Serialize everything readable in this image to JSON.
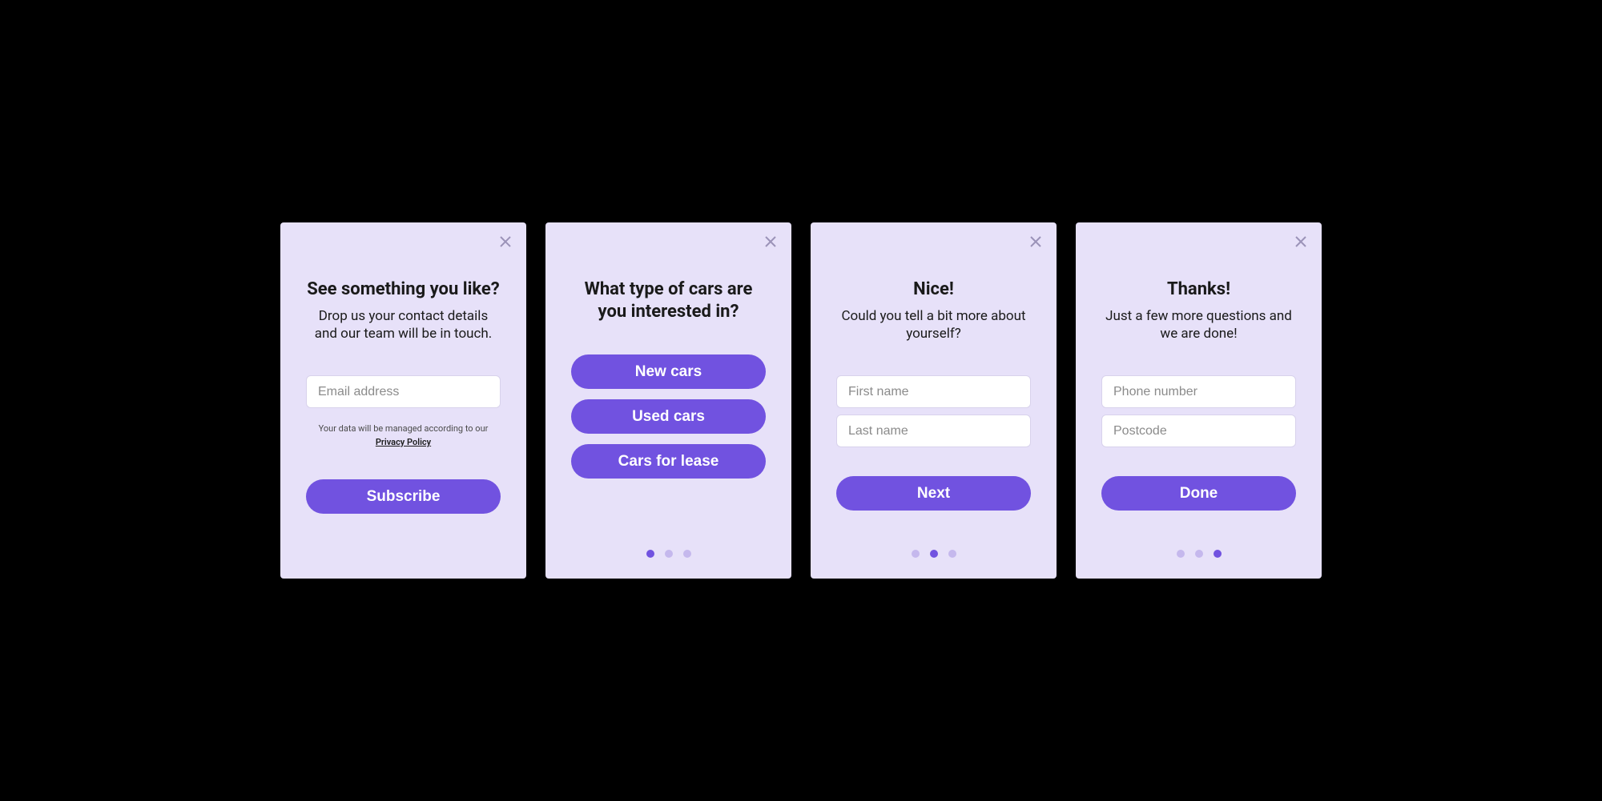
{
  "colors": {
    "accent": "#7152e0",
    "card_bg": "#e7e1f9"
  },
  "cards": [
    {
      "title": "See something you like?",
      "subtitle": "Drop us your contact details and our team will be in touch.",
      "email_placeholder": "Email address",
      "disclaimer_prefix": "Your data will be managed according to our ",
      "disclaimer_link": "Privacy Policy",
      "subscribe_label": "Subscribe"
    },
    {
      "title": "What type of cars are you interested in?",
      "options": {
        "new": "New cars",
        "used": "Used cars",
        "lease": "Cars for lease"
      },
      "active_dot": 0
    },
    {
      "title": "Nice!",
      "subtitle": "Could you tell a bit more about yourself?",
      "first_placeholder": "First name",
      "last_placeholder": "Last name",
      "next_label": "Next",
      "active_dot": 1
    },
    {
      "title": "Thanks!",
      "subtitle": "Just a few more questions and we are done!",
      "phone_placeholder": "Phone number",
      "postcode_placeholder": "Postcode",
      "done_label": "Done",
      "active_dot": 2
    }
  ]
}
